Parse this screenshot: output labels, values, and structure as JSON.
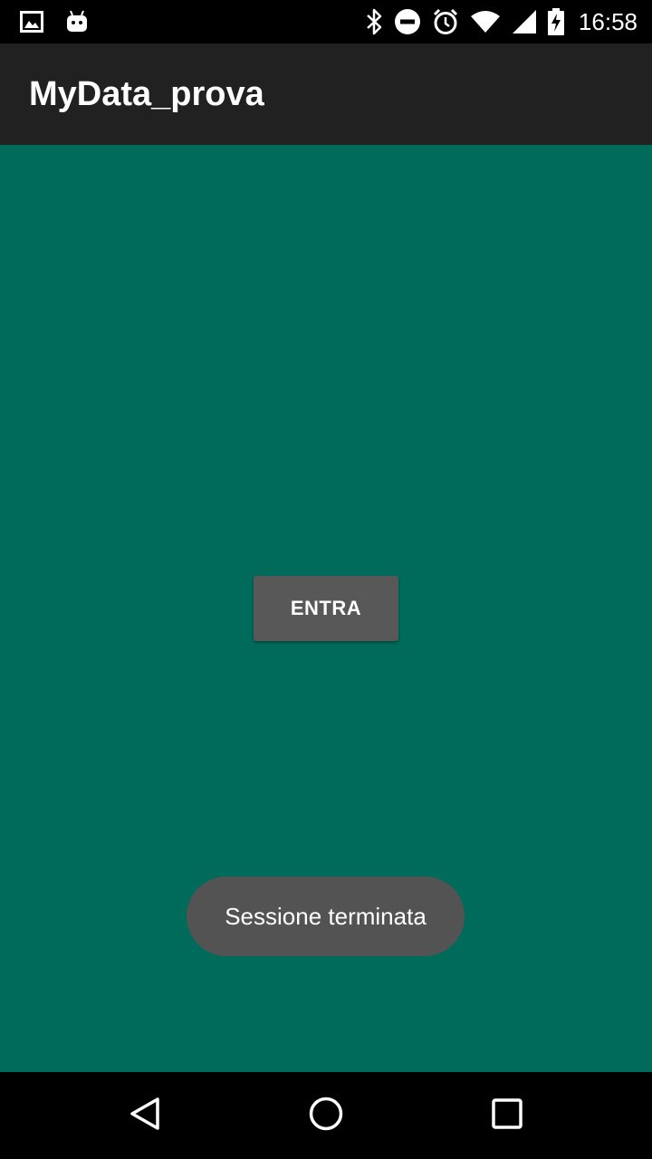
{
  "status_bar": {
    "time": "16:58",
    "left_icons": [
      "image-icon",
      "android-icon"
    ],
    "right_icons": [
      "bluetooth-icon",
      "do-not-disturb-icon",
      "alarm-icon",
      "wifi-icon",
      "cell-signal-icon",
      "battery-charging-icon"
    ]
  },
  "app_bar": {
    "title": "MyData_prova"
  },
  "main": {
    "enter_button_label": "ENTRA"
  },
  "toast": {
    "message": "Sessione terminata"
  },
  "nav_bar": {
    "icons": [
      "back-icon",
      "home-icon",
      "recents-icon"
    ]
  },
  "colors": {
    "status_bar": "#000000",
    "app_bar": "#212121",
    "background": "#006b5b",
    "button": "#585858",
    "toast": "#535353",
    "nav_bar": "#000000"
  }
}
